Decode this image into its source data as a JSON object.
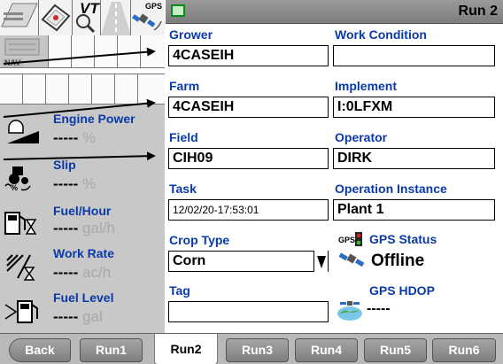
{
  "left": {
    "nav_label": "NAV",
    "icons": {
      "vt_label": "VT",
      "gps_label": "GPS"
    },
    "metrics": [
      {
        "label": "Engine Power",
        "value": "-----",
        "unit": "%",
        "icon": "engine-icon"
      },
      {
        "label": "Slip",
        "value": "-----",
        "unit": "%",
        "icon": "tractor-slip-icon"
      },
      {
        "label": "Fuel/Hour",
        "value": "-----",
        "unit": "gal/h",
        "icon": "fuel-pump-icon"
      },
      {
        "label": "Work Rate",
        "value": "-----",
        "unit": "ac/h",
        "icon": "work-rate-icon"
      },
      {
        "label": "Fuel Level",
        "value": "-----",
        "unit": "gal",
        "icon": "fuel-level-icon"
      }
    ]
  },
  "right": {
    "title": "Run 2",
    "fields": {
      "grower": {
        "label": "Grower",
        "value": "4CASEIH"
      },
      "work_condition": {
        "label": "Work Condition",
        "value": ""
      },
      "farm": {
        "label": "Farm",
        "value": "4CASEIH"
      },
      "implement": {
        "label": "Implement",
        "value": "I:0LFXM"
      },
      "field": {
        "label": "Field",
        "value": "CIH09"
      },
      "operator": {
        "label": "Operator",
        "value": "DIRK"
      },
      "task": {
        "label": "Task",
        "value": "12/02/20-17:53:01"
      },
      "operation_instance": {
        "label": "Operation Instance",
        "value": "Plant 1"
      },
      "crop_type": {
        "label": "Crop Type",
        "value": "Corn"
      },
      "tag": {
        "label": "Tag",
        "value": ""
      }
    },
    "gps": {
      "status_label": "GPS Status",
      "status_value": "Offline",
      "icon_label": "GPS",
      "hdop_label": "GPS HDOP",
      "hdop_value": "-----"
    }
  },
  "tabs": [
    "Back",
    "Run1",
    "Run2",
    "Run3",
    "Run4",
    "Run5",
    "Run6"
  ],
  "active_tab": "Run2",
  "colors": {
    "label_blue": "#0a3aa8",
    "unit_gray": "#a8a8a8",
    "tab_gray": "#8f8f8f",
    "panel_gray": "#c8c8c8",
    "arrow": "#000000"
  }
}
